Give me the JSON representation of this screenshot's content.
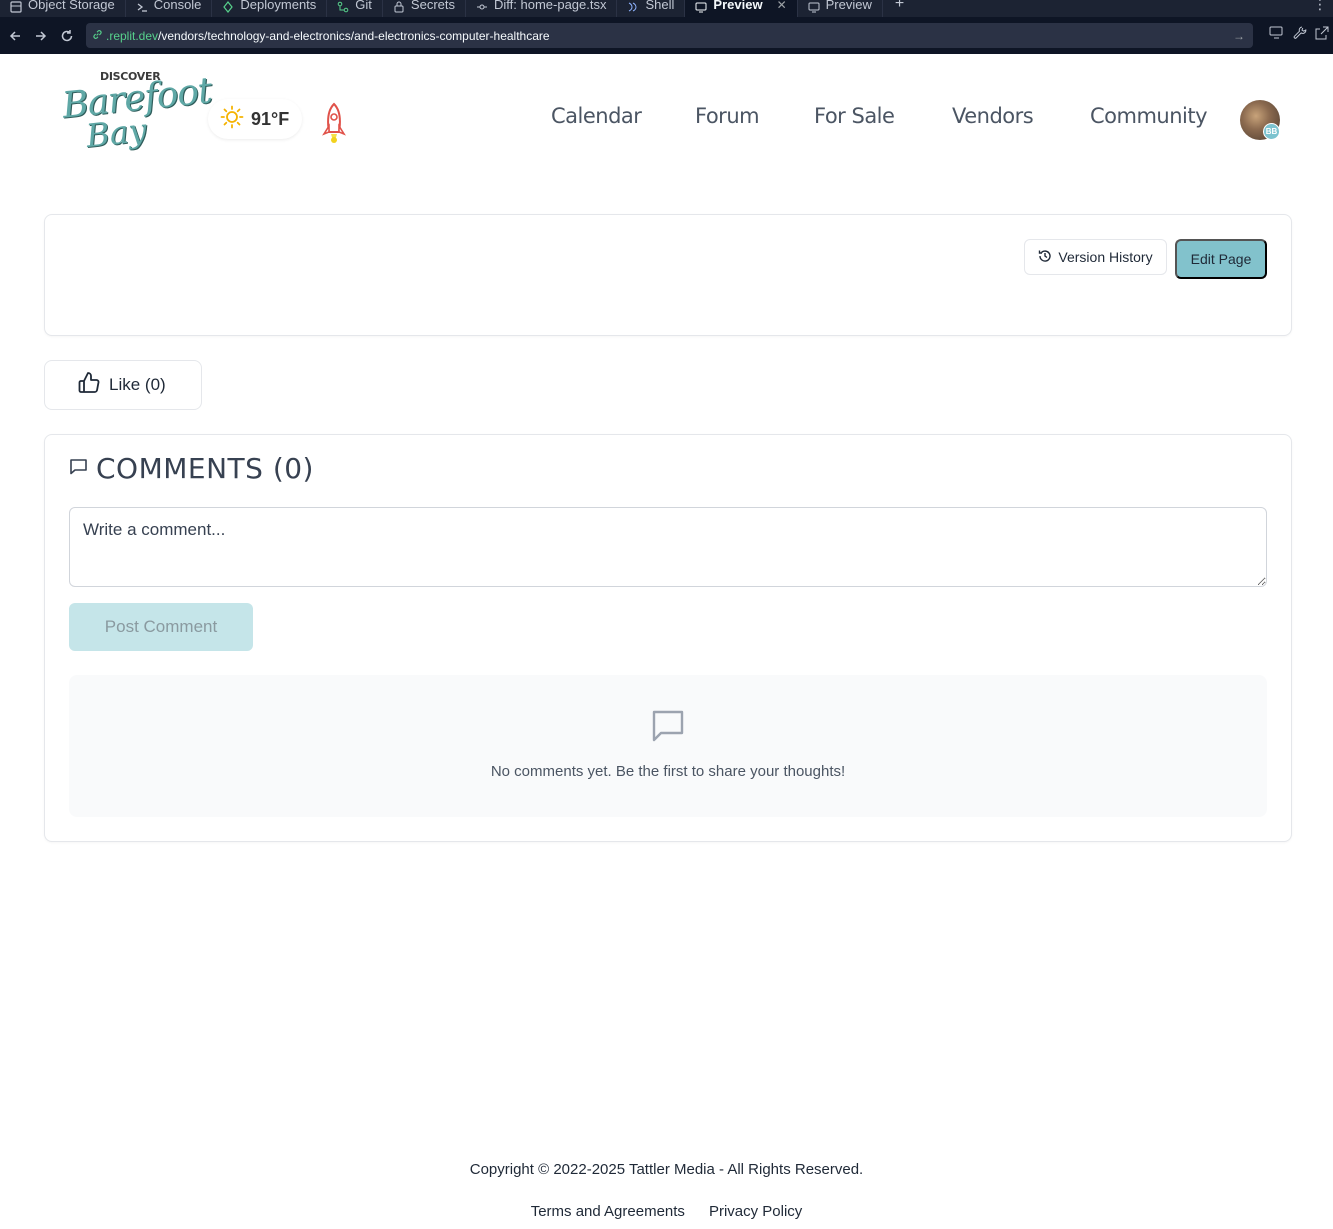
{
  "ide": {
    "tabs": [
      {
        "label": "Object Storage",
        "icon": "storage-icon"
      },
      {
        "label": "Console",
        "icon": "terminal-icon"
      },
      {
        "label": "Deployments",
        "icon": "deploy-icon"
      },
      {
        "label": "Git",
        "icon": "git-icon"
      },
      {
        "label": "Secrets",
        "icon": "lock-icon"
      },
      {
        "label": "Diff: home-page.tsx",
        "icon": "diff-icon"
      },
      {
        "label": "Shell",
        "icon": "shell-icon"
      },
      {
        "label": "Preview",
        "icon": "monitor-icon",
        "active": true,
        "closable": true
      },
      {
        "label": "Preview",
        "icon": "monitor-icon"
      }
    ],
    "add_tab": "+",
    "more": "⋮",
    "url_domain": ".replit.dev",
    "url_path": "/vendors/technology-and-electronics/and-electronics-computer-healthcare"
  },
  "site": {
    "logo_top": "DISCOVER",
    "logo_line1": "Barefoot",
    "logo_line2": "Bay",
    "weather_temp": "91°F",
    "nav": [
      "Calendar",
      "Forum",
      "For Sale",
      "Vendors",
      "Community"
    ],
    "avatar_badge": "BB"
  },
  "page": {
    "version_history_label": "Version History",
    "edit_page_label": "Edit Page",
    "like_label": "Like (0)",
    "comments_title": "COMMENTS (0)",
    "comment_placeholder": "Write a comment...",
    "post_comment_label": "Post Comment",
    "empty_message": "No comments yet. Be the first to share your thoughts!"
  },
  "footer": {
    "copyright": "Copyright © 2022-2025 Tattler Media - All Rights Reserved.",
    "links": [
      "Terms and Agreements",
      "Privacy Policy"
    ]
  },
  "colors": {
    "ide_bg": "#1c2333",
    "accent": "#82c2cc",
    "accent_light": "#c5e5e9",
    "logo_teal": "#5fa8a6"
  }
}
